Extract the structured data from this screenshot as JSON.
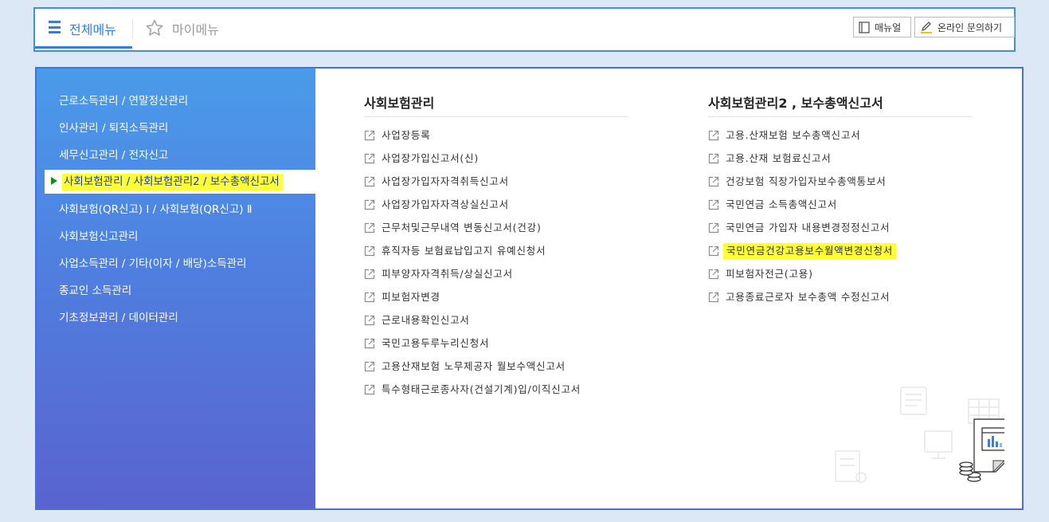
{
  "topbar": {
    "tab_all": "전체메뉴",
    "tab_my": "마이메뉴",
    "manual": "매뉴얼",
    "inquiry": "온라인 문의하기"
  },
  "sidebar": {
    "items": [
      "근로소득관리 / 연말정산관리",
      "인사관리 / 퇴직소득관리",
      "세무신고관리 / 전자신고",
      "사회보험관리 / 사회보험관리2 / 보수총액신고서",
      "사회보험(QR신고) Ⅰ / 사회보험(QR신고) Ⅱ",
      "사회보험신고관리",
      "사업소득관리 / 기타(이자 / 배당)소득관리",
      "종교인 소득관리",
      "기초정보관리 / 데이터관리"
    ],
    "active_index": 3
  },
  "columns": [
    {
      "title": "사회보험관리",
      "links": [
        "사업장등록",
        "사업장가입신고서(신)",
        "사업장가입자자격취득신고서",
        "사업장가입자자격상실신고서",
        "근무처및근무내역 변동신고서(건강)",
        "휴직자등 보험료납입고지 유예신청서",
        "피부양자자격취득/상실신고서",
        "피보험자변경",
        "근로내용확인신고서",
        "국민고용두루누리신청서",
        "고용산재보험 노무제공자 월보수액신고서",
        "특수형태근로종사자(건설기계)입/이직신고서"
      ]
    },
    {
      "title": "사회보험관리2 , 보수총액신고서",
      "links": [
        "고용.산재보험 보수총액신고서",
        "고용.산재 보험료신고서",
        "건강보험 직장가입자보수총액통보서",
        "국민연금 소득총액신고서",
        "국민연금 가입자 내용변경정정신고서",
        "국민연금건강고용보수월액변경신청서",
        "피보험자전근(고용)",
        "고용종료근로자 보수총액 수정신고서"
      ],
      "highlight_index": 5
    }
  ],
  "colors": {
    "accent": "#2f7fe0",
    "highlight": "#ffff33",
    "sidebar_top": "#4a9bea",
    "sidebar_bottom": "#5a63cf"
  }
}
